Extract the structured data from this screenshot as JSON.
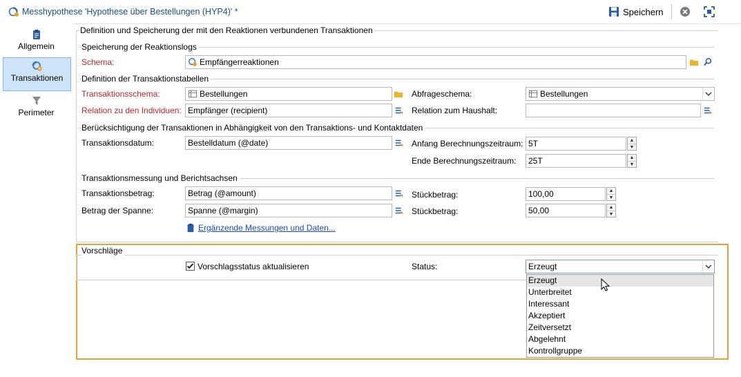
{
  "window": {
    "title": "Messhypothese 'Hypothese über Bestellungen (HYP4)' *",
    "save_label": "Speichern"
  },
  "sidebar": {
    "items": [
      {
        "label": "Allgemein",
        "icon": "clipboard-icon"
      },
      {
        "label": "Transaktionen",
        "icon": "transactions-icon",
        "active": true
      },
      {
        "label": "Perimeter",
        "icon": "funnel-icon"
      }
    ]
  },
  "main": {
    "group_title": "Definition und Speicherung der mit den Reaktionen verbundenen Transaktionen",
    "reaction_log": {
      "title": "Speicherung der Reaktionslogs",
      "schema_label": "Schema:",
      "schema_value": "Empfängerreaktionen"
    },
    "tables": {
      "title": "Definition der Transaktionstabellen",
      "tx_schema_label": "Transaktionsschema:",
      "tx_schema_value": "Bestellungen",
      "query_schema_label": "Abfrageschema:",
      "query_schema_value": "Bestellungen",
      "relation_ind_label": "Relation zu den Individuen:",
      "relation_ind_value": "Empfänger (recipient)",
      "relation_hh_label": "Relation zum Haushalt:",
      "relation_hh_value": ""
    },
    "consideration": {
      "title": "Berücksichtigung der Transaktionen in Abhängigkeit von den Transaktions- und Kontaktdaten",
      "tx_date_label": "Transaktionsdatum:",
      "tx_date_value": "Bestelldatum (@date)",
      "start_label": "Anfang Berechnungszeitraum:",
      "start_value": "5T",
      "end_label": "Ende Berechnungszeitraum:",
      "end_value": "25T"
    },
    "measure": {
      "title": "Transaktionsmessung und Berichtsachsen",
      "amount_label": "Transaktionsbetrag:",
      "amount_value": "Betrag (@amount)",
      "unit1_label": "Stückbetrag:",
      "unit1_value": "100,00",
      "margin_label": "Betrag der Spanne:",
      "margin_value": "Spanne (@margin)",
      "unit2_label": "Stückbetrag:",
      "unit2_value": "50,00",
      "extra_link": "Ergänzende Messungen und Daten..."
    },
    "proposals": {
      "title": "Vorschläge",
      "checkbox_label": "Vorschlagsstatus aktualisieren",
      "checked": true,
      "status_label": "Status:",
      "status_value": "Erzeugt",
      "options": [
        "Erzeugt",
        "Unterbreitet",
        "Interessant",
        "Akzeptiert",
        "Zeitversetzt",
        "Abgelehnt",
        "Kontrollgruppe"
      ],
      "highlighted_option": "Erzeugt"
    }
  },
  "colors": {
    "required_label": "#c0272d",
    "link": "#1a47c8",
    "highlight_border": "#f0a030",
    "sidebar_active": "#cde3f7"
  }
}
